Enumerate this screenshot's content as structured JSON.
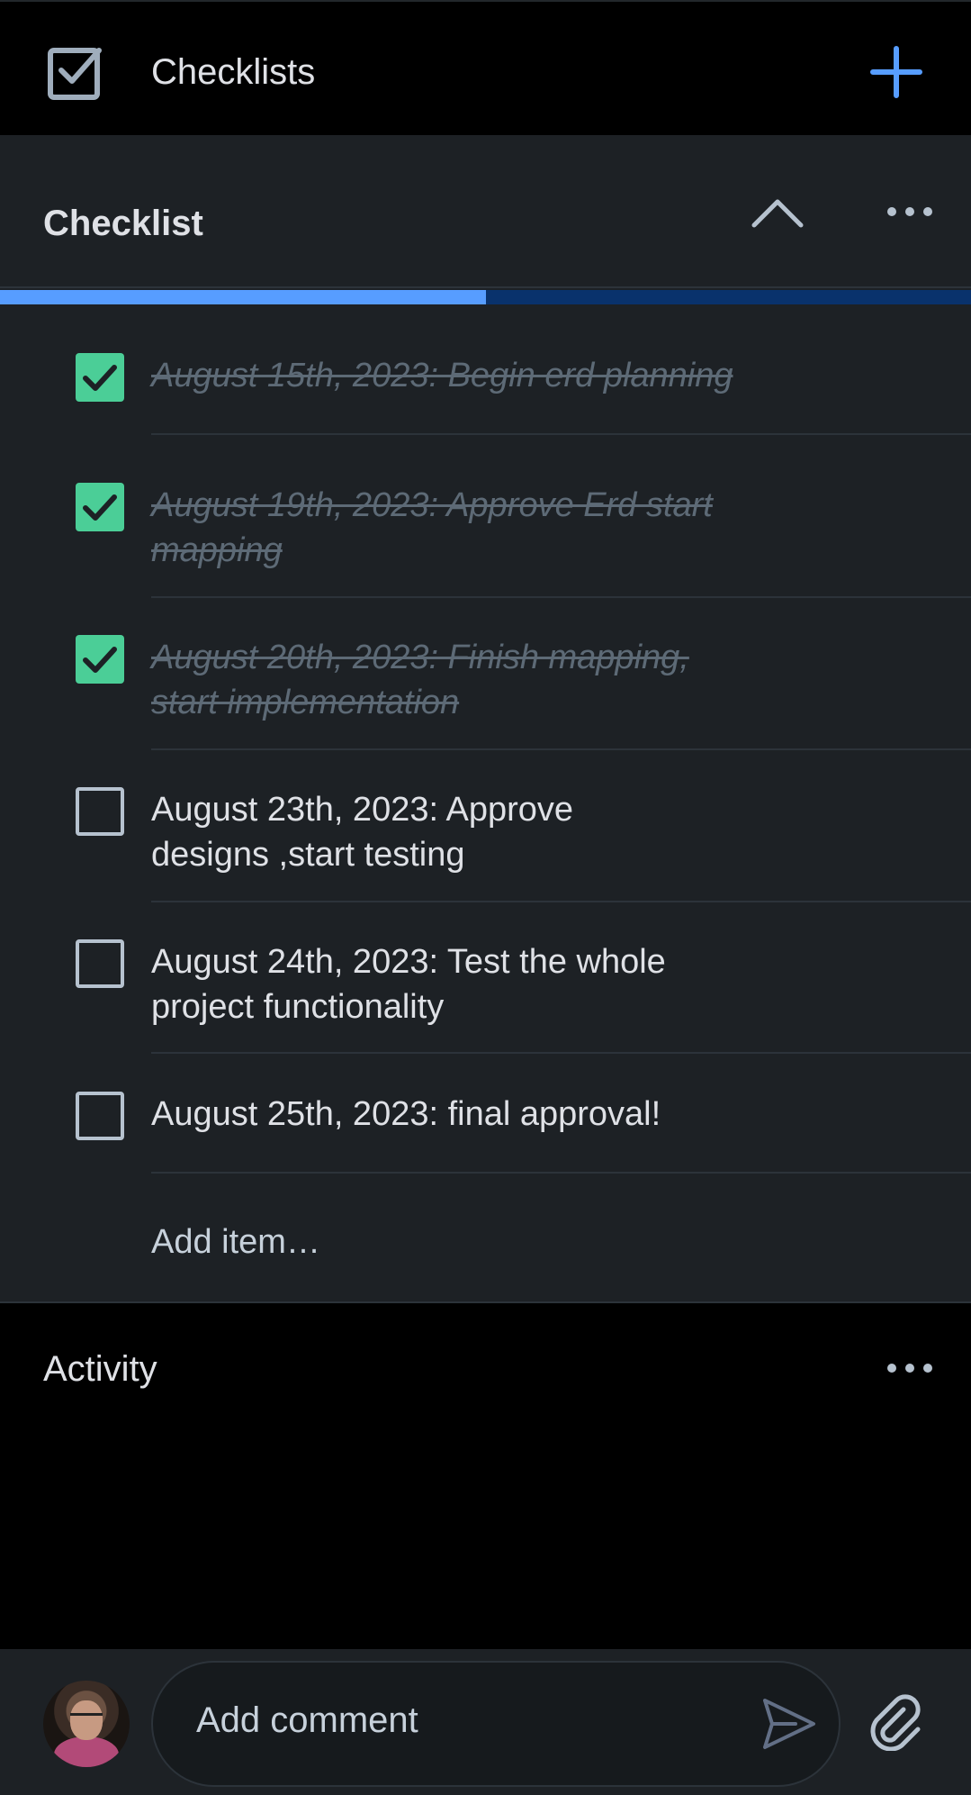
{
  "header": {
    "title": "Checklists"
  },
  "checklist": {
    "title": "Checklist",
    "progress_fraction": 0.5,
    "items": [
      {
        "lines": [
          "August 15th, 2023: Begin erd planning",
          ""
        ],
        "checked": true
      },
      {
        "lines": [
          "August 19th, 2023: Approve Erd start",
          "mapping"
        ],
        "checked": true
      },
      {
        "lines": [
          "August 20th, 2023: Finish mapping,",
          "start implementation"
        ],
        "checked": true
      },
      {
        "lines": [
          "August 23th, 2023: Approve",
          "designs ,start testing"
        ],
        "checked": false
      },
      {
        "lines": [
          "August 24th, 2023: Test the whole",
          "project functionality"
        ],
        "checked": false
      },
      {
        "lines": [
          "August 25th, 2023: final approval!",
          ""
        ],
        "checked": false
      }
    ],
    "add_item_label": "Add item…"
  },
  "activity": {
    "title": "Activity"
  },
  "comment": {
    "placeholder": "Add comment"
  },
  "colors": {
    "accent": "#579dff",
    "checked_green": "#4bce97",
    "progress_track": "#09326c",
    "panel_bg": "#1d2125"
  },
  "icons": [
    "checkbox-icon",
    "plus-icon",
    "chevron-up-icon",
    "more-icon",
    "send-icon",
    "paperclip-icon"
  ]
}
